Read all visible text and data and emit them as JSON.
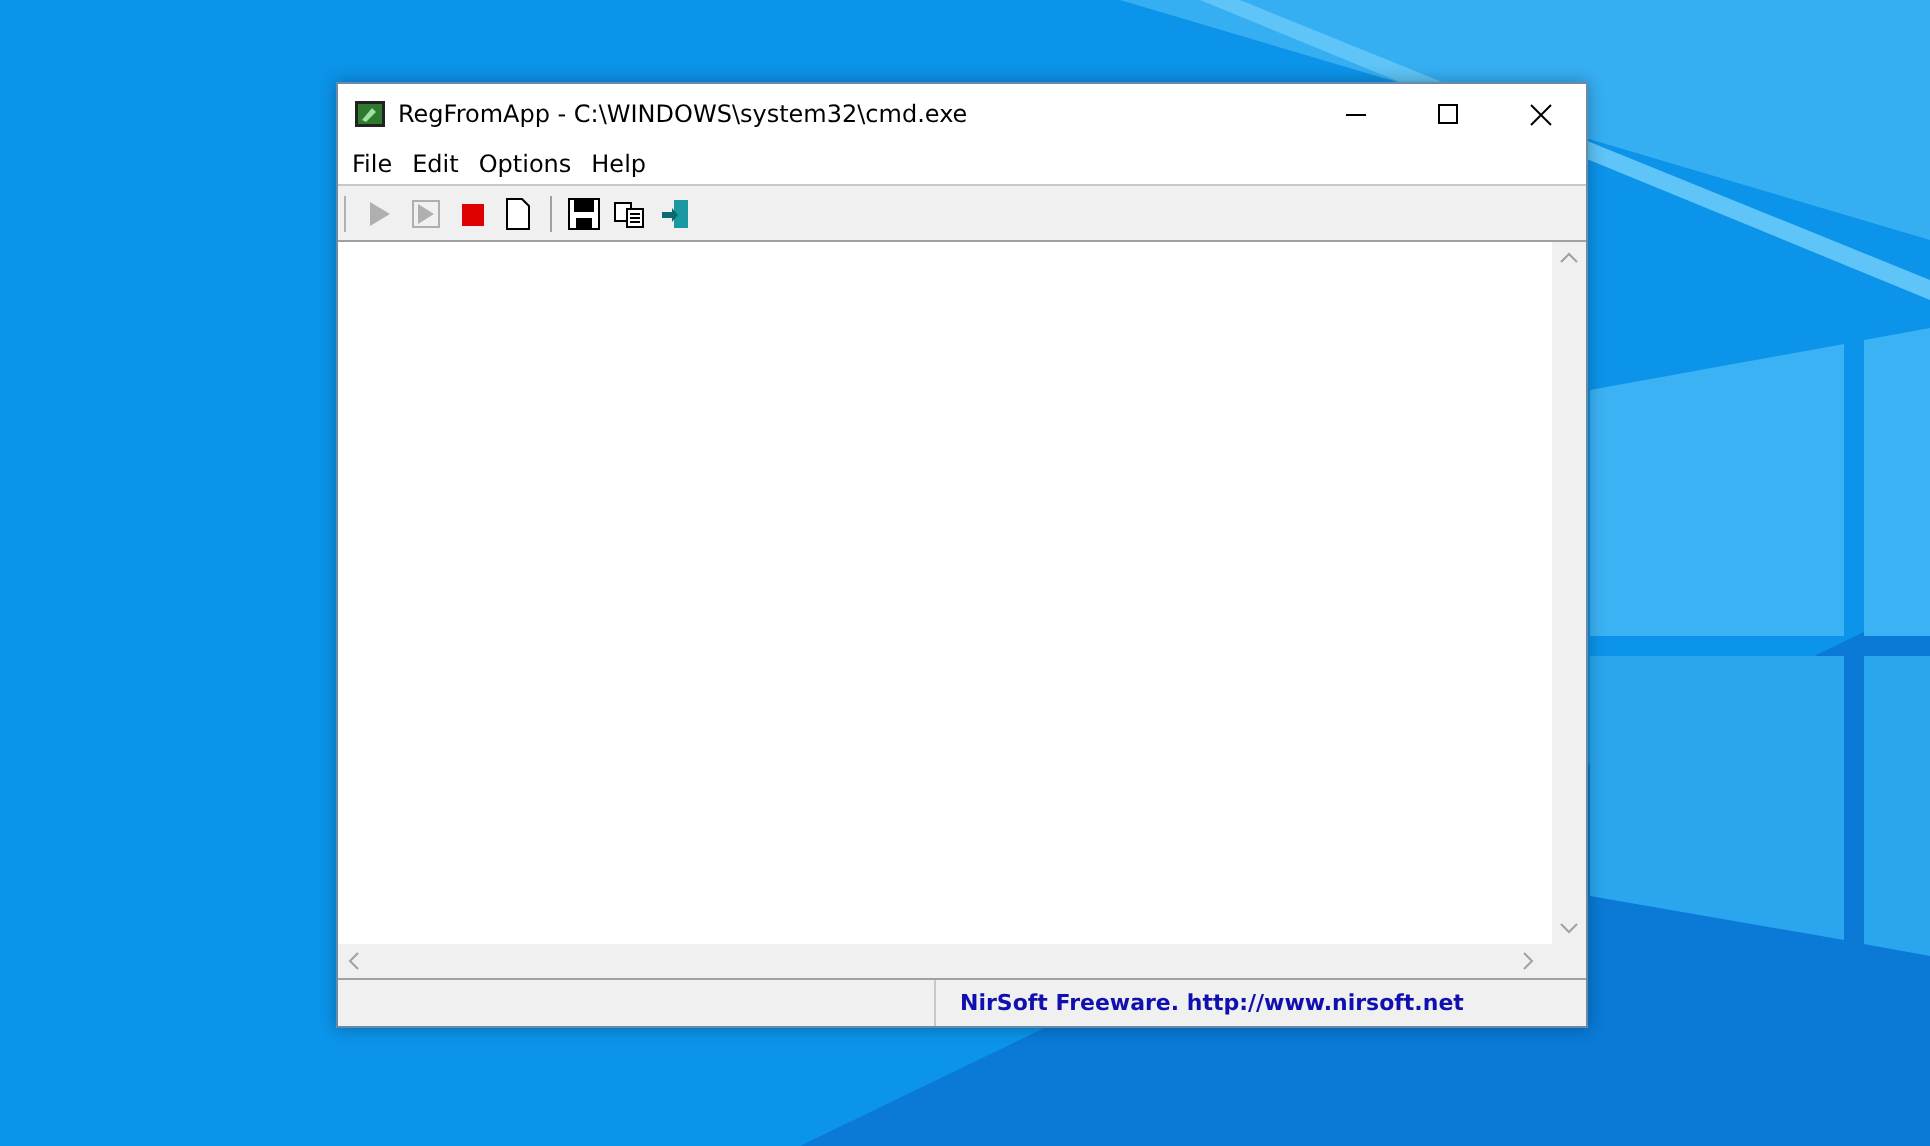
{
  "window": {
    "title": "RegFromApp  -  C:\\WINDOWS\\system32\\cmd.exe"
  },
  "menu": [
    "File",
    "Edit",
    "Options",
    "Help"
  ],
  "toolbar": [
    {
      "kind": "play",
      "disabled": true
    },
    {
      "kind": "play-step",
      "disabled": true
    },
    {
      "kind": "stop",
      "disabled": false
    },
    {
      "kind": "new",
      "disabled": false
    },
    {
      "kind": "separator"
    },
    {
      "kind": "save",
      "disabled": false
    },
    {
      "kind": "copy",
      "disabled": false
    },
    {
      "kind": "exit",
      "disabled": false
    }
  ],
  "status_bar": {
    "panel_2": "NirSoft Freeware.  http://www.nirsoft.net"
  }
}
